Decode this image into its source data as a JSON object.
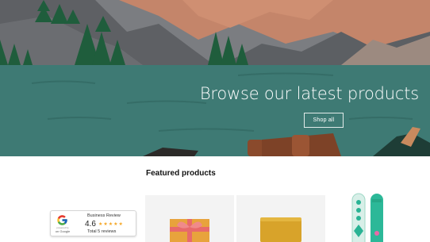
{
  "hero": {
    "heading": "Browse our latest products",
    "button_label": "Shop all"
  },
  "featured": {
    "title": "Featured products"
  },
  "review_badge": {
    "title": "Business Review",
    "score": "4.6",
    "stars": "★★★★★",
    "total": "Total 5 reviews",
    "caption_small": "powered by",
    "caption": "on Google"
  },
  "colors": {
    "sky": "#7a7c80",
    "mountain_tan": "#c4856a",
    "lake_teal": "#3e7a74",
    "trees": "#1f5d3c",
    "log_brown": "#8a4a2c",
    "star": "#f5a623"
  }
}
